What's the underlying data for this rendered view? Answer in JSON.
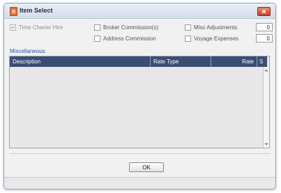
{
  "window": {
    "title": "Item Select"
  },
  "options": {
    "time_charter_hire": {
      "label": "Time Charter Hire",
      "checked": true,
      "disabled": true
    },
    "broker_commission": {
      "label": "Broker Commission(s)",
      "checked": false
    },
    "address_commission": {
      "label": "Address Commission",
      "checked": false
    },
    "misc_adjustments": {
      "label": "Misc Adjustments",
      "checked": false,
      "count": "0"
    },
    "voyage_expenses": {
      "label": "Voyage Expenses",
      "checked": false,
      "count": "0"
    }
  },
  "miscellaneous": {
    "label": "Miscellaneous",
    "columns": {
      "description": "Description",
      "rate_type": "Rate Type",
      "rate": "Rate",
      "s": "S"
    },
    "rows": []
  },
  "buttons": {
    "ok": "OK"
  },
  "colors": {
    "grid_header": "#3b4d72",
    "link_label": "#2352b8",
    "close_button": "#c9412b"
  }
}
